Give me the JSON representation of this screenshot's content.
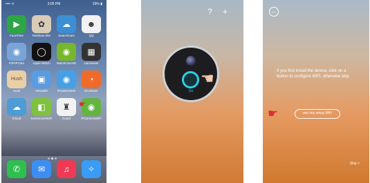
{
  "phone_home": {
    "status": {
      "carrier": "•••• ᯤ",
      "time": "3:05 PM",
      "battery": "29% ▮"
    },
    "apps": [
      {
        "label": "FaceTime",
        "color": "#2ea645",
        "glyph": "▶"
      },
      {
        "label": "Rainbow Skn",
        "color": "#d8cbb8",
        "glyph": "✿"
      },
      {
        "label": "SearchCam",
        "color": "#3c8fd4",
        "glyph": "☁"
      },
      {
        "label": "QQ",
        "color": "#f2f2f2",
        "glyph": "☻"
      },
      {
        "label": "P2PIPCam",
        "color": "#7aa4d8",
        "glyph": "◉"
      },
      {
        "label": "Apple Watch",
        "color": "#111111",
        "glyph": "◯"
      },
      {
        "label": "WatchCamHD",
        "color": "#78b62e",
        "glyph": "◉"
      },
      {
        "label": "camviewer",
        "color": "#333333",
        "glyph": "▦"
      },
      {
        "label": "Hush",
        "color": "#e8cfa8",
        "glyph": "Hush"
      },
      {
        "label": "Viewsafe",
        "color": "#5b9be0",
        "glyph": "▣"
      },
      {
        "label": "IPCameraHD",
        "color": "#47a0e6",
        "glyph": "◉"
      },
      {
        "label": "Eloviewer",
        "color": "#f06a2a",
        "glyph": "◔"
      },
      {
        "label": "iCloud",
        "color": "#4d9cd6",
        "glyph": "☁"
      },
      {
        "label": "SocksCamWiFi",
        "color": "#7fc240",
        "glyph": "◧"
      },
      {
        "label": "Guard",
        "color": "#f2f2f2",
        "glyph": "♜"
      },
      {
        "label": "IPCameraWiFi",
        "color": "#64b540",
        "glyph": "◉"
      }
    ],
    "dock": [
      {
        "label": "Phone",
        "color": "#2ec04e",
        "glyph": "✆"
      },
      {
        "label": "Mail",
        "color": "#3d8ef2",
        "glyph": "✉"
      },
      {
        "label": "Music",
        "color": "#f03a55",
        "glyph": "♫"
      },
      {
        "label": "Safari",
        "color": "#3a9cf4",
        "glyph": "✧"
      }
    ]
  },
  "phone_camera": {
    "help_icon": "?",
    "add_icon": "+",
    "go_label": "Go"
  },
  "phone_setup": {
    "back_icon": "←",
    "message": "If you first install the device, click on a button to configure WiFi, otherwise skip",
    "one_key_button": "one key setup WiFi",
    "skip_label": "Skip >"
  }
}
